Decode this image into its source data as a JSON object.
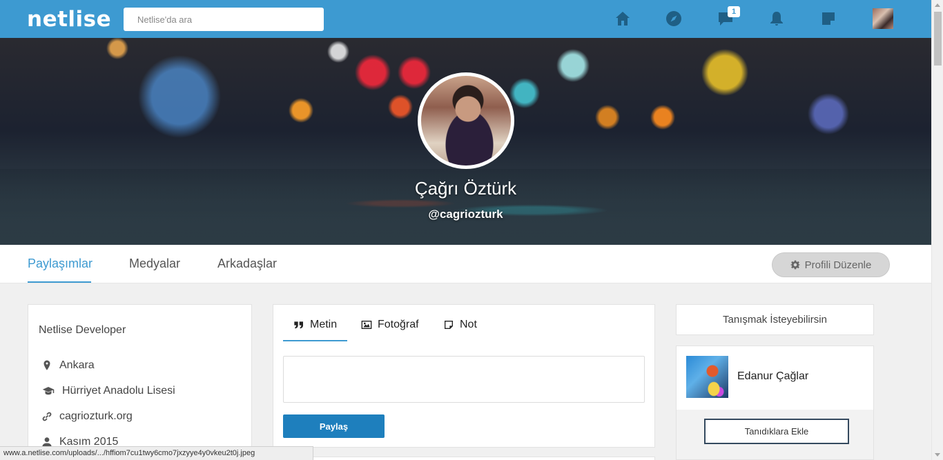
{
  "brand": {
    "logo": "netlise",
    "accent": "#3d9ad1"
  },
  "search": {
    "placeholder": "Netlise'da ara"
  },
  "nav": {
    "icons": [
      "home-icon",
      "compass-icon",
      "messages-icon",
      "bell-icon",
      "note-icon"
    ],
    "messages_badge": "1"
  },
  "profile": {
    "name": "Çağrı Öztürk",
    "handle": "@cagriozturk"
  },
  "tabs": [
    {
      "label": "Paylaşımlar",
      "active": true
    },
    {
      "label": "Medyalar",
      "active": false
    },
    {
      "label": "Arkadaşlar",
      "active": false
    }
  ],
  "edit_profile": {
    "label": "Profili Düzenle"
  },
  "about": {
    "title": "Netlise Developer",
    "items": [
      {
        "icon": "map-marker-icon",
        "text": "Ankara"
      },
      {
        "icon": "graduation-cap-icon",
        "text": "Hürriyet Anadolu Lisesi"
      },
      {
        "icon": "link-icon",
        "text": "cagriozturk.org"
      },
      {
        "icon": "user-icon",
        "text": "Kasım 2015"
      }
    ]
  },
  "composer": {
    "tabs": [
      {
        "icon": "quote-icon",
        "label": "Metin",
        "active": true
      },
      {
        "icon": "image-icon",
        "label": "Fotoğraf",
        "active": false
      },
      {
        "icon": "note-icon",
        "label": "Not",
        "active": false
      }
    ],
    "text_value": "",
    "submit_label": "Paylaş"
  },
  "suggestions": {
    "title": "Tanışmak İsteyebilirsin",
    "people": [
      {
        "name": "Edanur Çağlar",
        "action": "Tanıdıklara Ekle"
      }
    ]
  },
  "status_url": "www.a.netlise.com/uploads/.../hffiom7cu1twy6cmo7jxzyye4y0vkeu2t0j.jpeg"
}
